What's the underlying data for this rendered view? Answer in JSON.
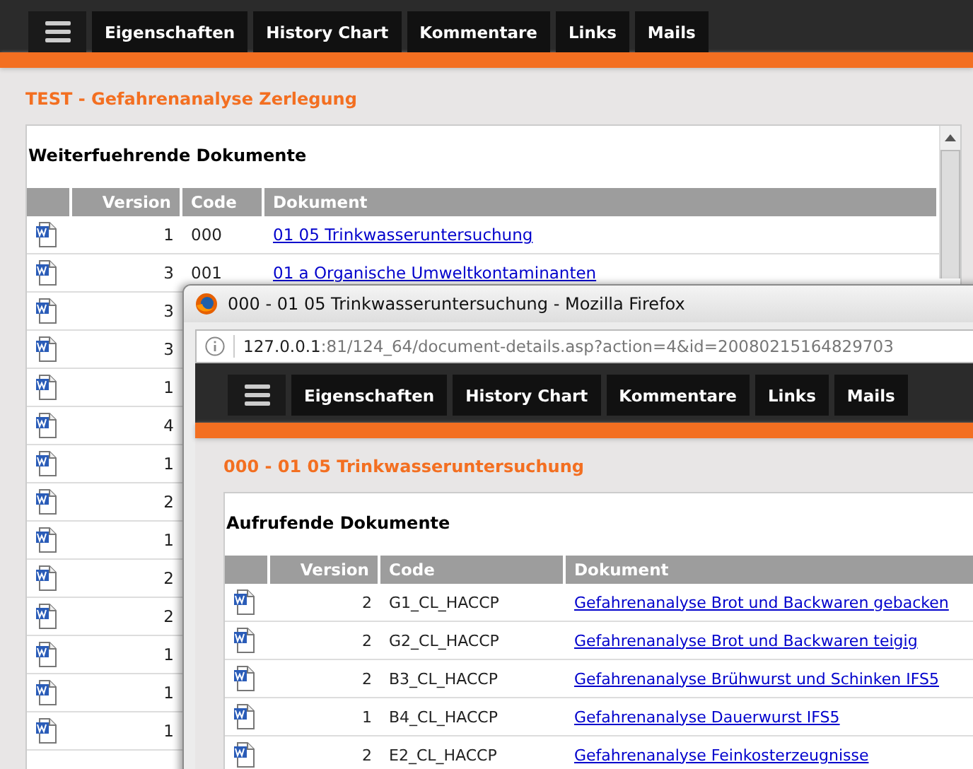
{
  "nav": {
    "tabs": [
      "Eigenschaften",
      "History Chart",
      "Kommentare",
      "Links",
      "Mails"
    ]
  },
  "page_title": "TEST - Gefahrenanalyse Zerlegung",
  "panel": {
    "heading": "Weiterfuehrende Dokumente",
    "columns": [
      "Version",
      "Code",
      "Dokument"
    ],
    "rows": [
      {
        "version": "1",
        "code": "000",
        "document": "01 05 Trinkwasseruntersuchung"
      },
      {
        "version": "3",
        "code": "001",
        "document": "01 a Organische Umweltkontaminanten"
      },
      {
        "version": "3"
      },
      {
        "version": "3"
      },
      {
        "version": "1"
      },
      {
        "version": "4"
      },
      {
        "version": "1"
      },
      {
        "version": "2"
      },
      {
        "version": "1"
      },
      {
        "version": "2"
      },
      {
        "version": "2"
      },
      {
        "version": "1"
      },
      {
        "version": "1"
      },
      {
        "version": "1"
      }
    ]
  },
  "popup": {
    "window_title": "000 - 01 05 Trinkwasseruntersuchung - Mozilla Firefox",
    "url": {
      "host": "127.0.0.1",
      "path": ":81/124_64/document-details.asp?action=4&id=20080215164829703"
    },
    "nav": {
      "tabs": [
        "Eigenschaften",
        "History Chart",
        "Kommentare",
        "Links",
        "Mails"
      ]
    },
    "page_title": "000 - 01 05 Trinkwasseruntersuchung",
    "panel": {
      "heading": "Aufrufende Dokumente",
      "columns": [
        "Version",
        "Code",
        "Dokument"
      ],
      "rows": [
        {
          "version": "2",
          "code": "G1_CL_HACCP",
          "document": "Gefahrenanalyse Brot und Backwaren gebacken"
        },
        {
          "version": "2",
          "code": "G2_CL_HACCP",
          "document": "Gefahrenanalyse Brot und Backwaren teigig"
        },
        {
          "version": "2",
          "code": "B3_CL_HACCP",
          "document": "Gefahrenanalyse Brühwurst und Schinken IFS5"
        },
        {
          "version": "1",
          "code": "B4_CL_HACCP",
          "document": "Gefahrenanalyse Dauerwurst IFS5"
        },
        {
          "version": "2",
          "code": "E2_CL_HACCP",
          "document": "Gefahrenanalyse Feinkosterzeugnisse"
        }
      ]
    }
  }
}
